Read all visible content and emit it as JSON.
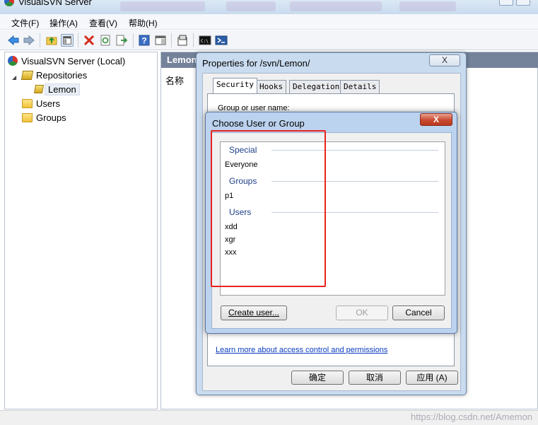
{
  "window": {
    "title": "VisualSVN Server"
  },
  "menu": [
    "文件(F)",
    "操作(A)",
    "查看(V)",
    "帮助(H)"
  ],
  "toolbar": [
    "back-icon",
    "forward-icon",
    "up-folder-icon",
    "show-hide-tree-icon",
    "delete-icon",
    "refresh-icon",
    "export-icon",
    "help-icon",
    "properties-icon",
    "settings-icon",
    "console-icon",
    "powershell-icon"
  ],
  "tree": {
    "root": "VisualSVN Server (Local)",
    "repositories": "Repositories",
    "lemon": "Lemon",
    "users": "Users",
    "groups": "Groups"
  },
  "right_pane": {
    "header": "Lemon",
    "column_name": "名称"
  },
  "properties": {
    "title": "Properties for /svn/Lemon/",
    "close": "X",
    "tabs": [
      "Security",
      "Hooks",
      "Delegation",
      "Details"
    ],
    "group_label": "Group or user name:",
    "learn_link": "Learn more about access control and permissions",
    "ok": "确定",
    "cancel": "取消",
    "apply": "应用 (A)"
  },
  "choose": {
    "title": "Choose User or Group",
    "close": "X",
    "sections": {
      "special": {
        "title": "Special",
        "items": [
          "Everyone"
        ]
      },
      "groups": {
        "title": "Groups",
        "items": [
          "p1"
        ]
      },
      "users": {
        "title": "Users",
        "items": [
          "xdd",
          "xgr",
          "xxx"
        ]
      }
    },
    "create_user": "Create user...",
    "ok": "OK",
    "cancel": "Cancel"
  },
  "watermark": "https://blog.csdn.net/Amemon"
}
